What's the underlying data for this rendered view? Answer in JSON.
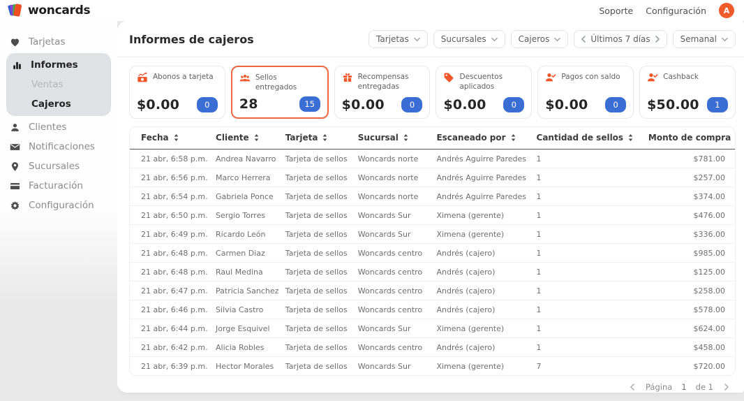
{
  "header": {
    "logo_text": "woncards",
    "nav": [
      {
        "label": "Soporte"
      },
      {
        "label": "Configuración"
      }
    ],
    "avatar_initial": "A"
  },
  "sidebar": {
    "items": [
      {
        "label": "Tarjetas",
        "icon": "heart-icon"
      },
      {
        "children": [
          {
            "label": "Informes",
            "icon": "bar-chart-icon",
            "active": true
          },
          {
            "label": "Ventas",
            "sub": true,
            "muted": true
          },
          {
            "label": "Cajeros",
            "sub": true,
            "active": true
          }
        ]
      },
      {
        "label": "Clientes",
        "icon": "person-icon"
      },
      {
        "label": "Notificaciones",
        "icon": "envelope-icon"
      },
      {
        "label": "Sucursales",
        "icon": "map-pin-icon"
      },
      {
        "label": "Facturación",
        "icon": "credit-card-icon"
      },
      {
        "label": "Configuración",
        "icon": "gear-icon"
      }
    ]
  },
  "main": {
    "title": "Informes de cajeros",
    "filters": [
      {
        "label": "Tarjetas",
        "type": "dropdown"
      },
      {
        "label": "Sucursales",
        "type": "dropdown"
      },
      {
        "label": "Cajeros",
        "type": "dropdown"
      },
      {
        "label": "Últimos 7 días",
        "type": "date-nav"
      },
      {
        "label": "Semanal",
        "type": "dropdown"
      }
    ],
    "stat_cards": [
      {
        "title": "Abonos a tarjeta",
        "value": "$0.00",
        "badge": "0",
        "icon": "cash-icon",
        "selected": false
      },
      {
        "title": "Sellos entregados",
        "value": "28",
        "badge": "15",
        "icon": "people-icon",
        "selected": true
      },
      {
        "title": "Recompensas entregadas",
        "value": "$0.00",
        "badge": "0",
        "icon": "gift-icon",
        "selected": false
      },
      {
        "title": "Descuentos aplicados",
        "value": "$0.00",
        "badge": "0",
        "icon": "tag-icon",
        "selected": false
      },
      {
        "title": "Pagos con saldo",
        "value": "$0.00",
        "badge": "0",
        "icon": "person-check-icon",
        "selected": false
      },
      {
        "title": "Cashback",
        "value": "$50.00",
        "badge": "1",
        "icon": "person-check-icon",
        "selected": false
      }
    ],
    "table": {
      "columns": [
        "Fecha",
        "Cliente",
        "Tarjeta",
        "Sucursal",
        "Escaneado por",
        "Cantidad de sellos",
        "Monto de compra"
      ],
      "rows": [
        [
          "21 abr, 6:58 p.m.",
          "Andrea Navarro",
          "Tarjeta de sellos",
          "Woncards norte",
          "Andrés Aguirre Paredes",
          "1",
          "$781.00"
        ],
        [
          "21 abr, 6:56 p.m.",
          "Marco Herrera",
          "Tarjeta de sellos",
          "Woncards norte",
          "Andrés Aguirre Paredes",
          "1",
          "$257.00"
        ],
        [
          "21 abr, 6:54 p.m.",
          "Gabriela Ponce",
          "Tarjeta de sellos",
          "Woncards norte",
          "Andrés Aguirre Paredes",
          "1",
          "$374.00"
        ],
        [
          "21 abr, 6:50 p.m.",
          "Sergio Torres",
          "Tarjeta de sellos",
          "Woncards Sur",
          "Ximena (gerente)",
          "1",
          "$476.00"
        ],
        [
          "21 abr, 6:49 p.m.",
          "Ricardo León",
          "Tarjeta de sellos",
          "Woncards Sur",
          "Ximena (gerente)",
          "1",
          "$336.00"
        ],
        [
          "21 abr, 6:48 p.m.",
          "Carmen Diaz",
          "Tarjeta de sellos",
          "Woncards centro",
          "Andrés (cajero)",
          "1",
          "$985.00"
        ],
        [
          "21 abr, 6:48 p.m.",
          "Raul Medina",
          "Tarjeta de sellos",
          "Woncards centro",
          "Andrés (cajero)",
          "1",
          "$125.00"
        ],
        [
          "21 abr, 6:47 p.m.",
          "Patricia Sanchez",
          "Tarjeta de sellos",
          "Woncards centro",
          "Andrés (cajero)",
          "1",
          "$258.00"
        ],
        [
          "21 abr, 6:46 p.m.",
          "Silvia Castro",
          "Tarjeta de sellos",
          "Woncards centro",
          "Andrés (cajero)",
          "1",
          "$578.00"
        ],
        [
          "21 abr, 6:44 p.m.",
          "Jorge Esquivel",
          "Tarjeta de sellos",
          "Woncards Sur",
          "Ximena (gerente)",
          "1",
          "$624.00"
        ],
        [
          "21 abr, 6:42 p.m.",
          "Alicia Robles",
          "Tarjeta de sellos",
          "Woncards centro",
          "Andrés (cajero)",
          "1",
          "$458.00"
        ],
        [
          "21 abr, 6:39 p.m.",
          "Hector Morales",
          "Tarjeta de sellos",
          "Woncards Sur",
          "Ximena (gerente)",
          "7",
          "$720.00"
        ]
      ]
    },
    "pagination": {
      "label": "Página",
      "page": "1",
      "of_label": "de 1"
    }
  },
  "colors": {
    "accent_orange": "#F2572C",
    "selected_border": "#F0653E",
    "badge_blue": "#3A6ED5",
    "avatar_orange": "#F15A29"
  }
}
